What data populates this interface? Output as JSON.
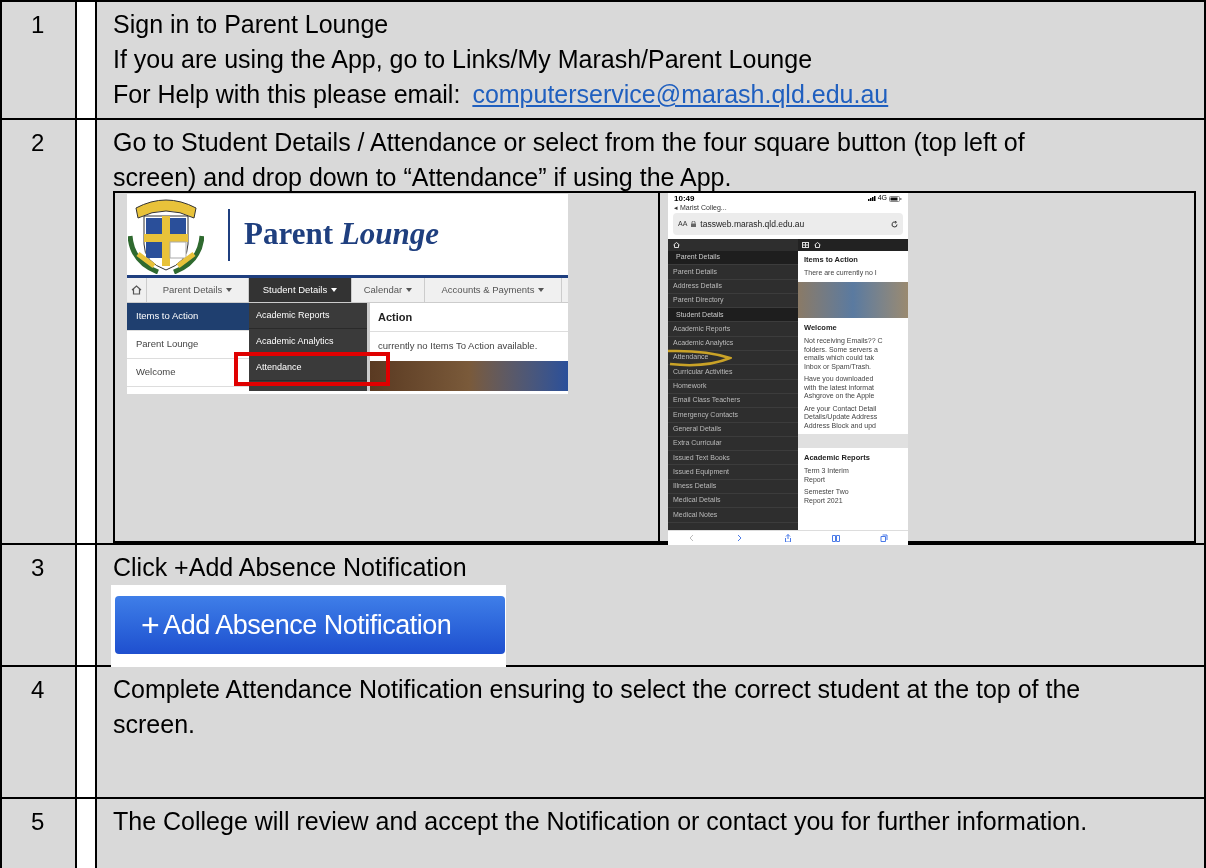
{
  "steps": [
    {
      "number": "1",
      "lines": [
        "Sign in to Parent Lounge",
        "If you are using the App, go to Links/My Marash/Parent Lounge"
      ],
      "help": {
        "text": "For Help with this please email:",
        "link": "computerservice@marash.qld.edu.au"
      }
    },
    {
      "number": "2",
      "lines": [
        "Go to Student Details / Attendance or select from the four square button (top left of screen) and drop down to “Attendance” if using the App."
      ],
      "desktop_screenshot": {
        "title": "Parent *Lounge*",
        "nav": [
          {
            "label": "Parent Details",
            "selected": false
          },
          {
            "label": "Student Details",
            "selected": true
          },
          {
            "label": "Calendar",
            "selected": false
          },
          {
            "label": "Accounts & Payments",
            "selected": false
          }
        ],
        "sidebar": [
          {
            "label": "Items to Action",
            "selected": true
          },
          {
            "label": "Parent Lounge",
            "selected": false
          },
          {
            "label": "Welcome",
            "selected": false
          }
        ],
        "dropdown": [
          {
            "label": "Academic Reports",
            "highlighted": false
          },
          {
            "label": "Academic Analytics",
            "highlighted": false
          },
          {
            "label": "Attendance",
            "highlighted": true
          }
        ],
        "heading": "Action",
        "message": "currently no Items To Action available."
      },
      "mobile_screenshot": {
        "time": "10:49",
        "back": "◂ Marist Colleg...",
        "network": "4G",
        "text_size": "AA",
        "url": "tassweb.marash.qld.edu.au",
        "menu": [
          {
            "label": "Parent Details",
            "kind": "header",
            "circled": false
          },
          {
            "label": "Parent Details",
            "kind": "item",
            "circled": false
          },
          {
            "label": "Address Details",
            "kind": "item",
            "circled": false
          },
          {
            "label": "Parent Directory",
            "kind": "item",
            "circled": false
          },
          {
            "label": "Student Details",
            "kind": "header",
            "circled": false
          },
          {
            "label": "Academic Reports",
            "kind": "item",
            "circled": false
          },
          {
            "label": "Academic Analytics",
            "kind": "item",
            "circled": false
          },
          {
            "label": "Attendance",
            "kind": "item",
            "circled": true
          },
          {
            "label": "Curricular Activities",
            "kind": "item",
            "circled": false
          },
          {
            "label": "Homework",
            "kind": "item",
            "circled": false
          },
          {
            "label": "Email Class Teachers",
            "kind": "item",
            "circled": false
          },
          {
            "label": "Emergency Contacts",
            "kind": "item",
            "circled": false
          },
          {
            "label": "General Details",
            "kind": "item",
            "circled": false
          },
          {
            "label": "Extra Curricular",
            "kind": "item",
            "circled": false
          },
          {
            "label": "Issued Text Books",
            "kind": "item",
            "circled": false
          },
          {
            "label": "Issued Equipment",
            "kind": "item",
            "circled": false
          },
          {
            "label": "Illness Details",
            "kind": "item",
            "circled": false
          },
          {
            "label": "Medical Details",
            "kind": "item",
            "circled": false
          },
          {
            "label": "Medical Notes",
            "kind": "item",
            "circled": false
          }
        ],
        "content": [
          {
            "kind": "heading",
            "text": "Items to Action"
          },
          {
            "kind": "text",
            "lines": [
              "There are currently no I"
            ]
          },
          {
            "kind": "photo"
          },
          {
            "kind": "heading",
            "text": "Welcome"
          },
          {
            "kind": "text",
            "lines": [
              "Not receiving Emails?? C",
              "folders. Some servers a",
              "emails which could tak",
              "Inbox or Spam/Trash."
            ]
          },
          {
            "kind": "text",
            "lines": [
              "Have you downloaded",
              "with the latest informat",
              "Ashgrove on the Apple"
            ]
          },
          {
            "kind": "text",
            "lines": [
              "Are your Contact Detail",
              "Details/Update Address",
              "Address Block and upd"
            ]
          },
          {
            "kind": "divider"
          },
          {
            "kind": "heading",
            "text": "Academic Reports"
          },
          {
            "kind": "text",
            "lines": [
              "Term 3 Interim",
              "Report"
            ]
          },
          {
            "kind": "text",
            "lines": [
              "Semester Two",
              "Report 2021"
            ]
          }
        ]
      }
    },
    {
      "number": "3",
      "lines": [
        "Click +Add Absence Notification"
      ],
      "button_image": {
        "icon": "+",
        "label": "Add Absence Notification"
      }
    },
    {
      "number": "4",
      "lines": [
        "Complete Attendance Notification ensuring to select the correct student at the top of the screen."
      ]
    },
    {
      "number": "5",
      "lines": [
        "The College will review and accept the Notification or contact you for further information."
      ]
    }
  ]
}
